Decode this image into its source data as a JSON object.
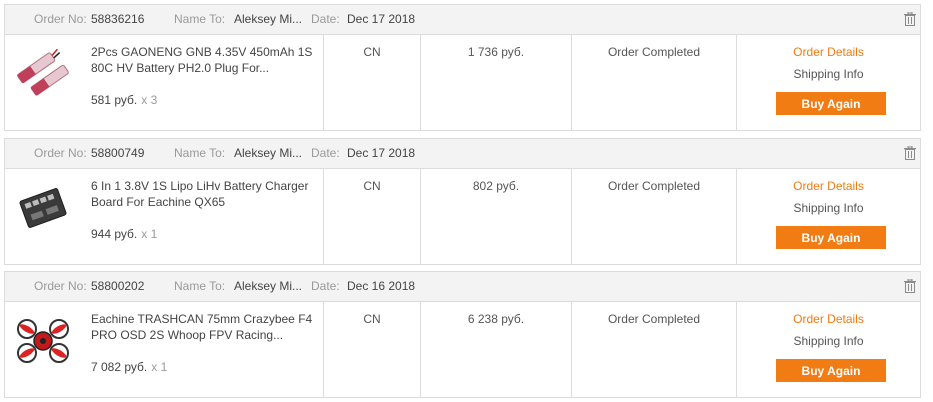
{
  "labels": {
    "order_no": "Order No:",
    "name_to": "Name To:",
    "date": "Date:",
    "order_details": "Order Details",
    "shipping_info": "Shipping Info",
    "buy_again": "Buy Again"
  },
  "colors": {
    "accent": "#f07c13",
    "header_bg": "#f3f3f3",
    "border": "#dcdcdc"
  },
  "orders": [
    {
      "order_no": "58836216",
      "name_to": "Aleksey Mi...",
      "date": "Dec 17 2018",
      "product_name": "2Pcs GAONENG GNB 4.35V 450mAh 1S 80C HV Battery PH2.0 Plug For...",
      "unit_price": "581 руб.",
      "quantity": "x 3",
      "warehouse": "CN",
      "total": "1 736 руб.",
      "status": "Order Completed",
      "thumb_icon": "battery-pack-icon"
    },
    {
      "order_no": "58800749",
      "name_to": "Aleksey Mi...",
      "date": "Dec 17 2018",
      "product_name": "6 In 1 3.8V 1S Lipo LiHv Battery Charger Board For Eachine QX65",
      "unit_price": "944 руб.",
      "quantity": "x 1",
      "warehouse": "CN",
      "total": "802 руб.",
      "status": "Order Completed",
      "thumb_icon": "charger-board-icon"
    },
    {
      "order_no": "58800202",
      "name_to": "Aleksey Mi...",
      "date": "Dec 16 2018",
      "product_name": "Eachine TRASHCAN 75mm Crazybee F4 PRO OSD 2S Whoop FPV Racing...",
      "unit_price": "7 082 руб.",
      "quantity": "x 1",
      "warehouse": "CN",
      "total": "6 238 руб.",
      "status": "Order Completed",
      "thumb_icon": "drone-icon"
    }
  ]
}
